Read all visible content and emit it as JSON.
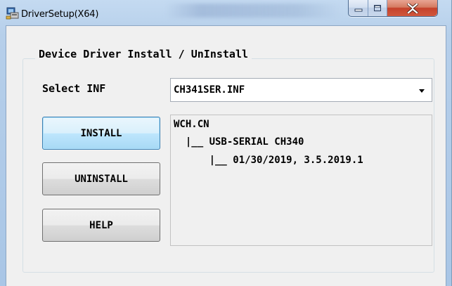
{
  "window": {
    "title": "DriverSetup(X64)",
    "icons": {
      "app": "driver-setup-icon",
      "minimize": "minimize-icon",
      "maximize": "maximize-icon",
      "close": "close-icon"
    },
    "colors": {
      "frame": "#b9d1ea",
      "close_button": "#c84a31",
      "client": "#f0f0f0"
    }
  },
  "group": {
    "label": "Device Driver Install / UnInstall"
  },
  "select": {
    "label": "Select INF",
    "value": "CH341SER.INF"
  },
  "buttons": {
    "install": "INSTALL",
    "uninstall": "UNINSTALL",
    "help": "HELP"
  },
  "info": {
    "line1": "WCH.CN",
    "line2": "  |__ USB-SERIAL CH340",
    "line3": "      |__ 01/30/2019, 3.5.2019.1"
  }
}
